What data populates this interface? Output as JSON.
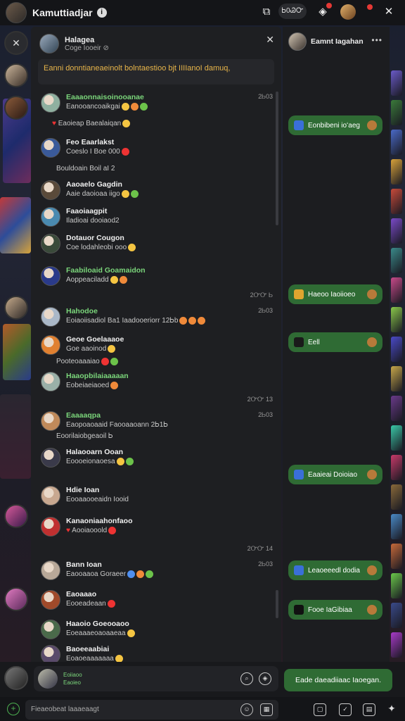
{
  "topbar": {
    "title": "Kamuttiadjar",
    "info_icon": "info-icon",
    "pill_label": "Ꮟ0ᏊᏅ",
    "icons": [
      "new-window-icon",
      "notification-icon",
      "profile-icon",
      "close-icon"
    ]
  },
  "chat": {
    "header": {
      "name": "Halagea",
      "subtitle": "Coge Iooeir ⊘"
    },
    "pinned": "Eanni donntianeaeinolt bolntaestioo bjt IIIIanoI damuq,",
    "messages": [
      {
        "name": "Eaaaonnaisoinooanae",
        "text": "Eanooancoaikgai",
        "time": "2Ꮟ03",
        "green": true,
        "emojis": [
          "y",
          "o",
          "g"
        ]
      },
      {
        "name": "",
        "text": "Eaoieap Baealaiqan",
        "time": "",
        "green": false,
        "emojis": [
          "y"
        ],
        "heart": true
      },
      {
        "name": "Feo Eaarlakst",
        "text": "Coeslo I Boe 000",
        "time": "",
        "green": false,
        "emojis": [
          "r"
        ]
      },
      {
        "name": "",
        "text": "Bouldoain  Boil aI 2",
        "time": "",
        "green": false,
        "emojis": []
      },
      {
        "name": "Aaoaelo Gagdin",
        "text": "Aaie daoioaa iigo",
        "time": "",
        "green": false,
        "emojis": [
          "y",
          "g"
        ]
      },
      {
        "name": "Faaoiaagpit",
        "text": "Iladioai dooiaod2",
        "time": "",
        "green": false,
        "emojis": []
      },
      {
        "name": "Dotauor Cougon",
        "text": "Coe lodahleobi ooo",
        "time": "",
        "green": false,
        "emojis": [
          "y"
        ]
      },
      {
        "name": "Faabiloaid Goamaidon",
        "text": "Aoppeaciladd",
        "time": "",
        "green": true,
        "emojis": [
          "y",
          "o"
        ]
      },
      {
        "name": "Hahodoe",
        "text": "Eoiaoiisadiol Ba1 Iaadooeriorr 12Ꮟb",
        "time": "2Ꮟ03",
        "green": true,
        "emojis": [
          "o",
          "o",
          "o"
        ]
      },
      {
        "name": "Geoe Goelaaaoe",
        "text": "Goe aaoinod",
        "time": "",
        "green": false,
        "emojis": [
          "y"
        ]
      },
      {
        "name": "",
        "text": "Pooteoaaaiao",
        "time": "",
        "green": false,
        "emojis": [
          "r",
          "g"
        ]
      },
      {
        "name": "Haaopbilaiaaaaan",
        "text": "Eobeiaeiaoed",
        "time": "",
        "green": true,
        "emojis": [
          "o"
        ]
      },
      {
        "name": "Eaaaaqpa",
        "text": "Eaopoaoaaid Faooaaoann 2Ꮟ1Ꮟ",
        "time": "2Ꮟ03",
        "green": true,
        "emojis": []
      },
      {
        "name": "",
        "text": "Eoorilaiobgeaoil  Ꮟ",
        "time": "",
        "green": false,
        "emojis": []
      },
      {
        "name": "Halaooarn Ooan",
        "text": "Eoooeionaoesa",
        "time": "",
        "green": false,
        "emojis": [
          "y",
          "g"
        ]
      },
      {
        "name": "Hdie Ioan",
        "text": "Eooaaooeaidn Iooid",
        "time": "",
        "green": false,
        "emojis": []
      },
      {
        "name": "Kanaoniaahonfaoo",
        "text": "Aooiaooold",
        "time": "",
        "green": false,
        "emojis": [
          "r"
        ],
        "heart": true
      },
      {
        "name": "Bann Ioan",
        "text": "Eaooaaoa Goraeer",
        "time": "2Ꮟ03",
        "green": false,
        "emojis": [
          "b",
          "o",
          "g"
        ]
      },
      {
        "name": "Eaoaaao",
        "text": "Eooeadeaan",
        "time": "",
        "green": false,
        "emojis": [
          "r"
        ]
      },
      {
        "name": "Haaoio Goeooaoo",
        "text": "Eoeaaaeoaoaaeaa",
        "time": "",
        "green": false,
        "emojis": [
          "y"
        ]
      },
      {
        "name": "Baoeeaabiai",
        "text": "Eoaoeaaaaaaa",
        "time": "",
        "green": false,
        "emojis": [
          "y"
        ]
      }
    ],
    "timestamps": [
      "2ᏅᏅ Ꮟ",
      "2ᏅᏅ 13",
      "2ᏅᏅ 14"
    ],
    "extra_line_1": "Bouldoain  Boil aI 2",
    "extra_line_2": "Pooteoaaaiao",
    "extra_line_3": "Eoorilaiobgeaoil  Ꮟ"
  },
  "right": {
    "name": "Eamnt Iagahan",
    "bubbles": [
      {
        "text": "Eonbibeni ioʻaeg",
        "color": "#3a6fd8",
        "meta": ""
      },
      {
        "text": "Haeoo Iaoiioeo",
        "color": "#e0a52f",
        "meta": ""
      },
      {
        "text": "Eell",
        "color": "#1a1a1a",
        "meta": ""
      },
      {
        "text": "Eaaieai Doioiao",
        "color": "#3a6fd8",
        "meta": ""
      },
      {
        "text": "Leaoeeedl dodia",
        "color": "#3a6fd8",
        "meta": ""
      },
      {
        "text": "Fooe IaGibiaa",
        "color": "#111",
        "meta": ""
      }
    ]
  },
  "bottom": {
    "compose_text": "Eoiiaoo Eaoieo",
    "send_label": "Eade daeadiiaac Iaoegan.",
    "input_placeholder": "Fieaeobeat laaaeaagt"
  },
  "colors": {
    "accent_green": "#2f6b34",
    "panel": "#1e1f22",
    "background": "#141518"
  }
}
